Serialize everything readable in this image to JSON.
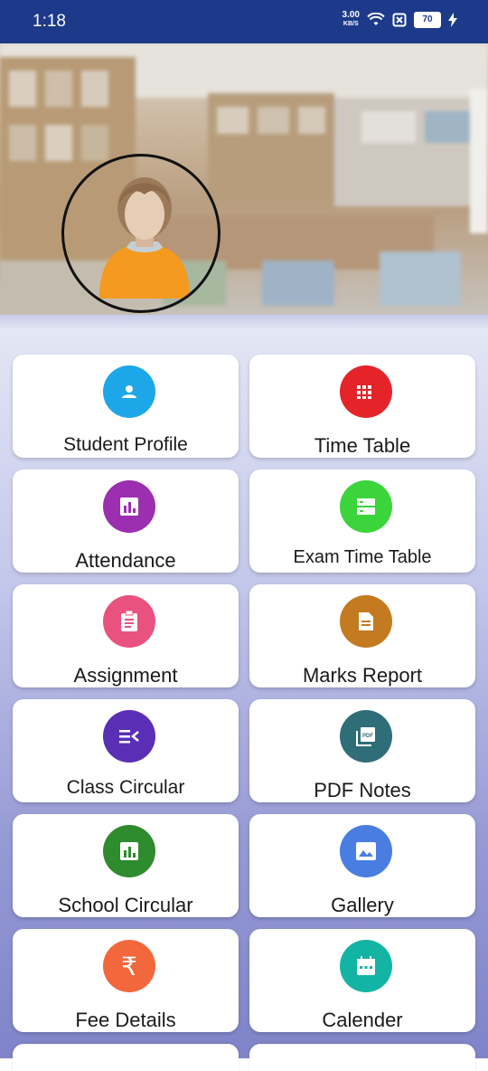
{
  "status_bar": {
    "time": "1:18",
    "network_speed": "3.00",
    "network_unit": "KB/S",
    "battery": "70"
  },
  "menu": [
    {
      "label": "Student Profile",
      "icon": "person-icon",
      "color": "#1ea7e8"
    },
    {
      "label": "Time Table",
      "icon": "grid-icon",
      "color": "#e5242a"
    },
    {
      "label": "Attendance",
      "icon": "bar-chart-icon",
      "color": "#9b2fb0"
    },
    {
      "label": "Exam Time Table",
      "icon": "storage-icon",
      "color": "#3bd43b"
    },
    {
      "label": "Assignment",
      "icon": "clipboard-icon",
      "color": "#e9527f"
    },
    {
      "label": "Marks Report",
      "icon": "document-icon",
      "color": "#c47a20"
    },
    {
      "label": "Class Circular",
      "icon": "list-icon",
      "color": "#5a2fb6"
    },
    {
      "label": "PDF Notes",
      "icon": "pdf-icon",
      "color": "#2f6e78"
    },
    {
      "label": "School Circular",
      "icon": "bar-chart-icon",
      "color": "#2e8b2e"
    },
    {
      "label": "Gallery",
      "icon": "image-icon",
      "color": "#4a7de2"
    },
    {
      "label": "Fee Details",
      "icon": "rupee-icon",
      "color": "#f2683c"
    },
    {
      "label": "Calender",
      "icon": "calendar-icon",
      "color": "#14b4a4"
    }
  ],
  "rupee_symbol": "₹",
  "pdf_text": "PDF"
}
